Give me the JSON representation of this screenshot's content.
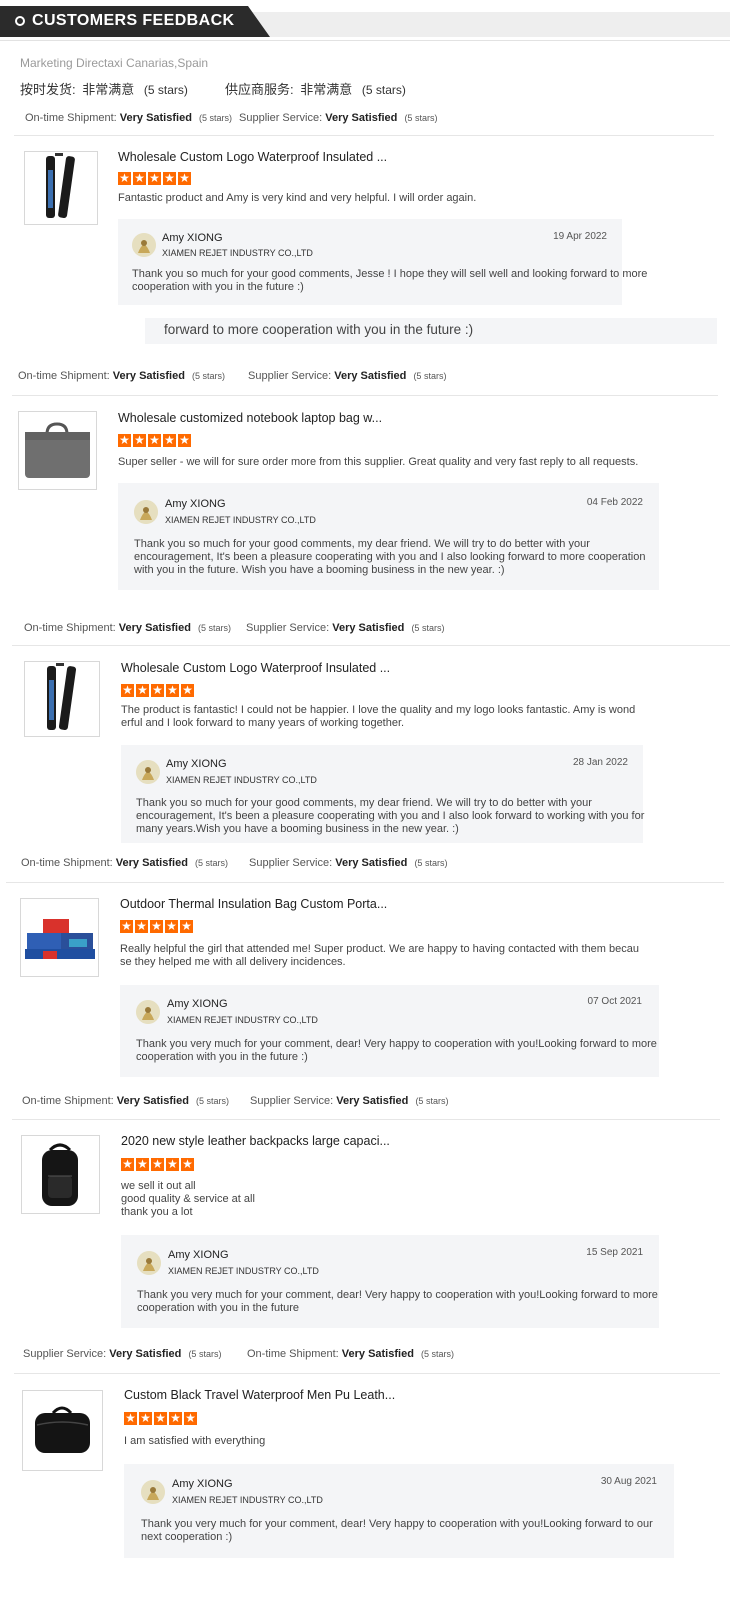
{
  "header": {
    "title": "CUSTOMERS FEEDBACK"
  },
  "buyer": {
    "company": "Marketing Directaxi Canarias,Spain"
  },
  "cn_ratings": {
    "shipment_label": "按时发货:",
    "shipment_value": "非常满意",
    "shipment_stars": "(5 stars)",
    "service_label": "供应商服务:",
    "service_value": "非常满意",
    "service_stars": "(5 stars)"
  },
  "rating_text": {
    "shipment": "On-time Shipment:",
    "service": "Supplier Service:",
    "value": "Very Satisfied",
    "stars": "(5 stars)"
  },
  "overflow_text": "forward to more cooperation with you in the future :)",
  "reviews": [
    {
      "title": "Wholesale Custom Logo Waterproof Insulated ...",
      "rating": 5,
      "comment": [
        "Fantastic product and Amy is very kind and very helpful. I will order again."
      ],
      "reply": {
        "name": "Amy XIONG",
        "company": "XIAMEN REJET INDUSTRY CO.,LTD",
        "date": "19 Apr 2022",
        "text": [
          "Thank you so much for your good comments, Jesse ! I hope they will sell well and looking forward to more",
          "cooperation with you in the future :)"
        ]
      }
    },
    {
      "title": "Wholesale customized notebook laptop bag w...",
      "rating": 5,
      "comment": [
        "Super seller - we will for sure order more from this supplier. Great quality and very fast reply to all requests."
      ],
      "reply": {
        "name": "Amy XIONG",
        "company": "XIAMEN REJET INDUSTRY CO.,LTD",
        "date": "04 Feb 2022",
        "text": [
          "Thank you so much for your good comments, my dear friend. We will try to do better with your",
          "encouragement, It's been a pleasure cooperating with you and I also looking forward to more cooperation",
          "with you in the future. Wish you have a booming business in the new year.  :)"
        ]
      }
    },
    {
      "title": "Wholesale Custom Logo Waterproof Insulated ...",
      "rating": 5,
      "comment": [
        "The product is fantastic! I could not be happier. I love the quality and my logo looks fantastic. Amy is wond",
        "erful and I look forward to many years of working together."
      ],
      "reply": {
        "name": "Amy XIONG",
        "company": "XIAMEN REJET INDUSTRY CO.,LTD",
        "date": "28 Jan 2022",
        "text": [
          "Thank you so much for your good comments, my dear friend. We will try to do better with your",
          "encouragement, It's been a pleasure cooperating with you and I also look forward to working with you for",
          "many years.Wish you have a booming business in the new year.  :)"
        ]
      }
    },
    {
      "title": "Outdoor Thermal Insulation Bag Custom Porta...",
      "rating": 5,
      "comment": [
        "Really helpful the girl that attended me! Super product. We are happy to having contacted with them becau",
        "se they helped me with all delivery incidences."
      ],
      "reply": {
        "name": "Amy XIONG",
        "company": "XIAMEN REJET INDUSTRY CO.,LTD",
        "date": "07 Oct 2021",
        "text": [
          "Thank you very much for your comment, dear! Very happy to cooperation with you!Looking forward to more",
          "cooperation with you in the future :)"
        ]
      }
    },
    {
      "title": "2020 new style leather backpacks large capaci...",
      "rating": 5,
      "comment": [
        "we sell it out all",
        "good quality & service at all",
        "thank you a lot"
      ],
      "reply": {
        "name": "Amy XIONG",
        "company": "XIAMEN REJET INDUSTRY CO.,LTD",
        "date": "15 Sep 2021",
        "text": [
          "Thank you very much for your comment, dear! Very happy to cooperation with you!Looking forward to more",
          "cooperation with you in the future"
        ]
      }
    },
    {
      "title": "Custom Black Travel Waterproof Men Pu Leath...",
      "rating": 5,
      "comment": [
        "I am satisfied with everything"
      ],
      "reply": {
        "name": "Amy XIONG",
        "company": "XIAMEN REJET INDUSTRY CO.,LTD",
        "date": "30 Aug 2021",
        "text": [
          "Thank you very much for your comment, dear! Very happy to cooperation with you!Looking forward to our",
          "next cooperation :)"
        ]
      }
    }
  ]
}
